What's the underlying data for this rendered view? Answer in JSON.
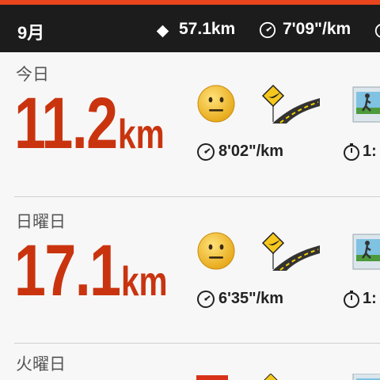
{
  "colors": {
    "accent": "#e8451e",
    "distance": "#c9340f",
    "header_bg": "#1c1c1c"
  },
  "header": {
    "month": "9月",
    "total_distance": "57.1km",
    "avg_pace": "7'09\"/km",
    "icons": [
      "distance-diamond-icon",
      "pace-gauge-icon"
    ]
  },
  "entries": [
    {
      "day": "今日",
      "distance": "11.2",
      "unit": "km",
      "pace": "8'02\"/km",
      "time": "1:",
      "mood": "neutral-face-icon",
      "terrain": "road-icon",
      "photo": "runner-photo-icon"
    },
    {
      "day": "日曜日",
      "distance": "17.1",
      "unit": "km",
      "pace": "6'35\"/km",
      "time": "1:",
      "mood": "neutral-face-icon",
      "terrain": "road-icon",
      "photo": "runner-photo-icon"
    },
    {
      "day": "火曜日"
    }
  ]
}
